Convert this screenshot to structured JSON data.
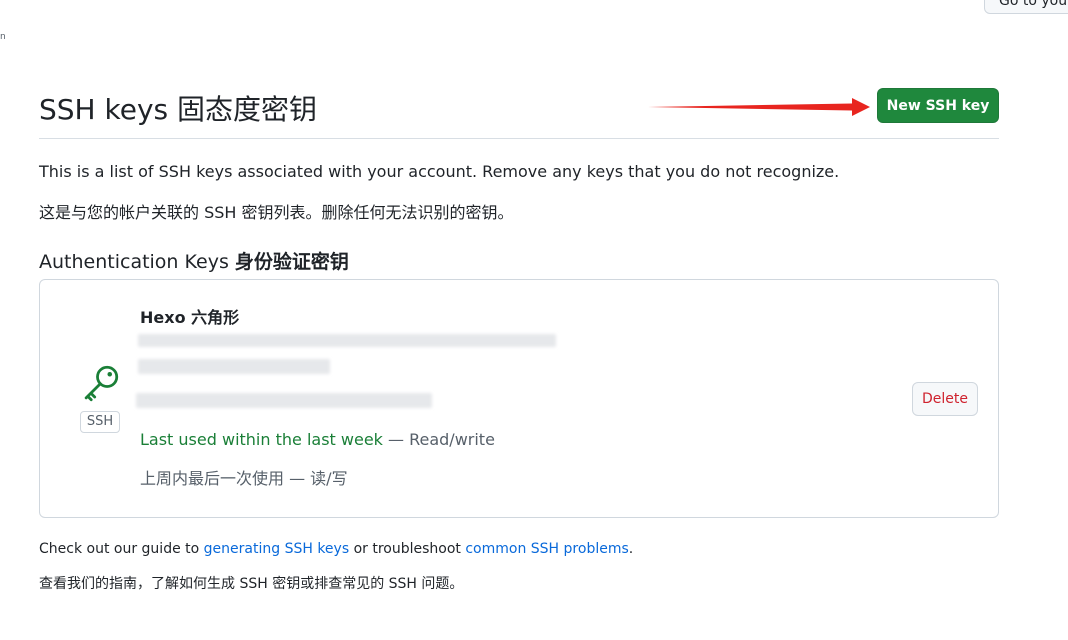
{
  "header": {
    "goto_label": "Go to your",
    "tiny_mark": "n"
  },
  "page": {
    "title": "SSH keys 固态度密钥",
    "new_key_label": "New SSH key",
    "arrow_color": "#e8251f",
    "desc_en": "This is a list of SSH keys associated with your account. Remove any keys that you do not recognize.",
    "desc_cn": "这是与您的帐户关联的 SSH 密钥列表。删除任何无法识别的密钥。"
  },
  "auth_section": {
    "title_en": "Authentication Keys",
    "title_cn": "身份验证密钥",
    "keys": [
      {
        "title": "Hexo 六角形",
        "badge": "SSH",
        "icon": "key-icon",
        "icon_color": "#1a7f37",
        "last_used": "Last used within the last week",
        "access": " — Read/write",
        "last_used_cn": "上周内最后一次使用 — 读/写",
        "delete_label": "Delete"
      }
    ]
  },
  "footer": {
    "prefix": "Check out our guide to ",
    "link1": "generating SSH keys",
    "middle": " or troubleshoot ",
    "link2": "common SSH problems",
    "suffix": ".",
    "cn": "查看我们的指南，了解如何生成 SSH 密钥或排查常见的 SSH 问题。"
  },
  "colors": {
    "primary_green": "#1f883d",
    "link_blue": "#0969da",
    "danger_red": "#cf222e",
    "border": "#d0d7de"
  }
}
